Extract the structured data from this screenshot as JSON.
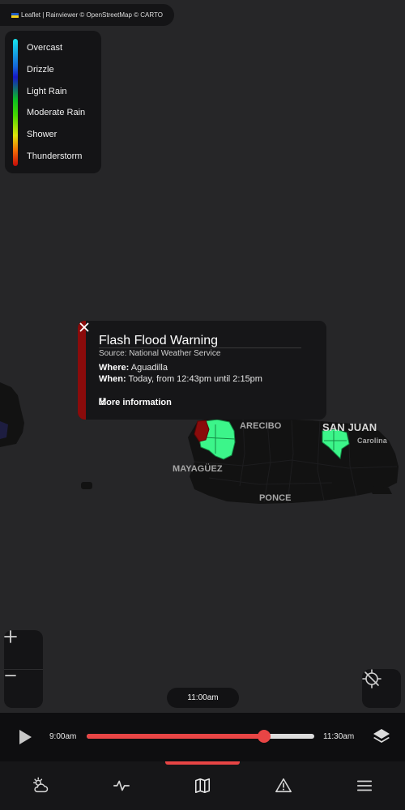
{
  "attribution": {
    "text": "Leaflet | Rainviewer © OpenStreetMap © CARTO"
  },
  "legend": {
    "items": [
      "Overcast",
      "Drizzle",
      "Light Rain",
      "Moderate Rain",
      "Shower",
      "Thunderstorm"
    ]
  },
  "map": {
    "cities": {
      "arecibo": "ARECIBO",
      "san_juan": "SAN JUAN",
      "carolina": "Carolina",
      "mayaguez": "MAYAGÜEZ",
      "ponce": "PONCE"
    },
    "colors": {
      "land": "#121212",
      "water": "#262628",
      "warning_zone": "#3cf58a",
      "alert_zone": "#8a0b0b"
    }
  },
  "popup": {
    "title": "Flash Flood Warning",
    "source": "Source: National Weather Service",
    "where_label": "Where:",
    "where_value": "Aguadilla",
    "when_label": "When:",
    "when_value": "Today, from 12:43pm until 2:15pm",
    "more_label": "More information",
    "accent": "#8a0b0b"
  },
  "controls": {
    "zoom_in": "+",
    "zoom_out": "−",
    "current_time": "11:00am"
  },
  "timeline": {
    "start": "9:00am",
    "end": "11:30am",
    "progress": 0.78,
    "accent": "#e84545"
  },
  "nav": {
    "items": [
      {
        "icon": "weather-icon",
        "active": false
      },
      {
        "icon": "activity-icon",
        "active": false
      },
      {
        "icon": "map-icon",
        "active": true
      },
      {
        "icon": "alert-icon",
        "active": false
      },
      {
        "icon": "menu-icon",
        "active": false
      }
    ]
  }
}
